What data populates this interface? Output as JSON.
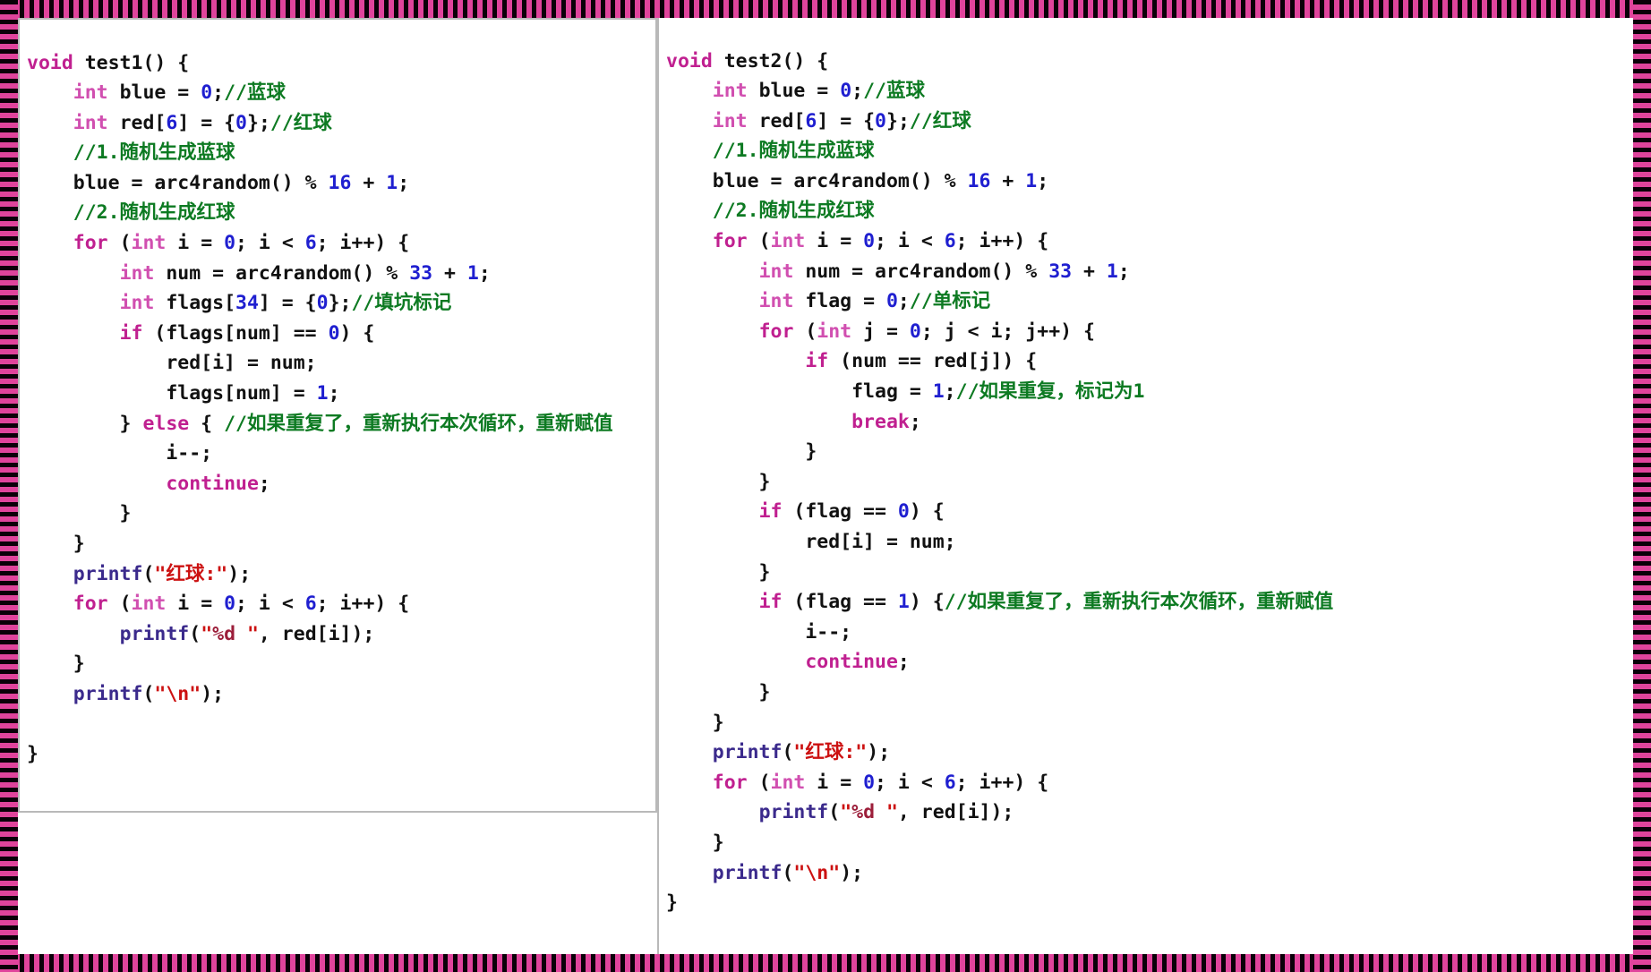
{
  "document": {
    "kind": "code-screenshot",
    "border_pattern": "magenta-black-stripes",
    "colors": {
      "border_magenta": "#e0449c",
      "border_black": "#0a0008",
      "panel_background": "#ffffff",
      "panel_border": "#b9b9b9",
      "keyword": "#c02090",
      "type": "#d14fb0",
      "number": "#1f1fd0",
      "comment": "#0d7a22",
      "string": "#cc1111",
      "format_spec": "#9c1e3a",
      "function": "#3b2a8c",
      "plain_text": "#111111"
    }
  },
  "panels": [
    {
      "id": "left",
      "function_name": "test1",
      "lines": [
        [
          {
            "t": "void",
            "c": "kw"
          },
          {
            "t": " test1() {",
            "c": "plain"
          }
        ],
        [
          {
            "t": "    ",
            "c": "plain"
          },
          {
            "t": "int",
            "c": "typ"
          },
          {
            "t": " blue = ",
            "c": "plain"
          },
          {
            "t": "0",
            "c": "num"
          },
          {
            "t": ";",
            "c": "plain"
          },
          {
            "t": "//蓝球",
            "c": "cmt"
          }
        ],
        [
          {
            "t": "    ",
            "c": "plain"
          },
          {
            "t": "int",
            "c": "typ"
          },
          {
            "t": " red[",
            "c": "plain"
          },
          {
            "t": "6",
            "c": "num"
          },
          {
            "t": "] = {",
            "c": "plain"
          },
          {
            "t": "0",
            "c": "num"
          },
          {
            "t": "};",
            "c": "plain"
          },
          {
            "t": "//红球",
            "c": "cmt"
          }
        ],
        [
          {
            "t": "    ",
            "c": "plain"
          },
          {
            "t": "//1.随机生成蓝球",
            "c": "cmt"
          }
        ],
        [
          {
            "t": "    blue = arc4random() % ",
            "c": "plain"
          },
          {
            "t": "16",
            "c": "num"
          },
          {
            "t": " + ",
            "c": "plain"
          },
          {
            "t": "1",
            "c": "num"
          },
          {
            "t": ";",
            "c": "plain"
          }
        ],
        [
          {
            "t": "    ",
            "c": "plain"
          },
          {
            "t": "//2.随机生成红球",
            "c": "cmt"
          }
        ],
        [
          {
            "t": "    ",
            "c": "plain"
          },
          {
            "t": "for",
            "c": "kw"
          },
          {
            "t": " (",
            "c": "plain"
          },
          {
            "t": "int",
            "c": "typ"
          },
          {
            "t": " i = ",
            "c": "plain"
          },
          {
            "t": "0",
            "c": "num"
          },
          {
            "t": "; i < ",
            "c": "plain"
          },
          {
            "t": "6",
            "c": "num"
          },
          {
            "t": "; i++) {",
            "c": "plain"
          }
        ],
        [
          {
            "t": "        ",
            "c": "plain"
          },
          {
            "t": "int",
            "c": "typ"
          },
          {
            "t": " num = arc4random() % ",
            "c": "plain"
          },
          {
            "t": "33",
            "c": "num"
          },
          {
            "t": " + ",
            "c": "plain"
          },
          {
            "t": "1",
            "c": "num"
          },
          {
            "t": ";",
            "c": "plain"
          }
        ],
        [
          {
            "t": "        ",
            "c": "plain"
          },
          {
            "t": "int",
            "c": "typ"
          },
          {
            "t": " flags[",
            "c": "plain"
          },
          {
            "t": "34",
            "c": "num"
          },
          {
            "t": "] = {",
            "c": "plain"
          },
          {
            "t": "0",
            "c": "num"
          },
          {
            "t": "};",
            "c": "plain"
          },
          {
            "t": "//填坑标记",
            "c": "cmt"
          }
        ],
        [
          {
            "t": "        ",
            "c": "plain"
          },
          {
            "t": "if",
            "c": "kw"
          },
          {
            "t": " (flags[num] == ",
            "c": "plain"
          },
          {
            "t": "0",
            "c": "num"
          },
          {
            "t": ") {",
            "c": "plain"
          }
        ],
        [
          {
            "t": "            red[i] = num;",
            "c": "plain"
          }
        ],
        [
          {
            "t": "            flags[num] = ",
            "c": "plain"
          },
          {
            "t": "1",
            "c": "num"
          },
          {
            "t": ";",
            "c": "plain"
          }
        ],
        [
          {
            "t": "        } ",
            "c": "plain"
          },
          {
            "t": "else",
            "c": "kw"
          },
          {
            "t": " { ",
            "c": "plain"
          },
          {
            "t": "//如果重复了，重新执行本次循环，重新赋值",
            "c": "cmt"
          }
        ],
        [
          {
            "t": "            i--;",
            "c": "plain"
          }
        ],
        [
          {
            "t": "            ",
            "c": "plain"
          },
          {
            "t": "continue",
            "c": "kw"
          },
          {
            "t": ";",
            "c": "plain"
          }
        ],
        [
          {
            "t": "        }",
            "c": "plain"
          }
        ],
        [
          {
            "t": "    }",
            "c": "plain"
          }
        ],
        [
          {
            "t": "    ",
            "c": "plain"
          },
          {
            "t": "printf",
            "c": "fn"
          },
          {
            "t": "(",
            "c": "plain"
          },
          {
            "t": "\"红球:\"",
            "c": "str"
          },
          {
            "t": ");",
            "c": "plain"
          }
        ],
        [
          {
            "t": "    ",
            "c": "plain"
          },
          {
            "t": "for",
            "c": "kw"
          },
          {
            "t": " (",
            "c": "plain"
          },
          {
            "t": "int",
            "c": "typ"
          },
          {
            "t": " i = ",
            "c": "plain"
          },
          {
            "t": "0",
            "c": "num"
          },
          {
            "t": "; i < ",
            "c": "plain"
          },
          {
            "t": "6",
            "c": "num"
          },
          {
            "t": "; i++) {",
            "c": "plain"
          }
        ],
        [
          {
            "t": "        ",
            "c": "plain"
          },
          {
            "t": "printf",
            "c": "fn"
          },
          {
            "t": "(",
            "c": "plain"
          },
          {
            "t": "\"",
            "c": "str"
          },
          {
            "t": "%d",
            "c": "fmt"
          },
          {
            "t": " \"",
            "c": "str"
          },
          {
            "t": ", red[i]);",
            "c": "plain"
          }
        ],
        [
          {
            "t": "    }",
            "c": "plain"
          }
        ],
        [
          {
            "t": "    ",
            "c": "plain"
          },
          {
            "t": "printf",
            "c": "fn"
          },
          {
            "t": "(",
            "c": "plain"
          },
          {
            "t": "\"",
            "c": "str"
          },
          {
            "t": "\\n",
            "c": "str"
          },
          {
            "t": "\"",
            "c": "str"
          },
          {
            "t": ");",
            "c": "plain"
          }
        ],
        [
          {
            "t": "",
            "c": "plain"
          }
        ],
        [
          {
            "t": "}",
            "c": "plain"
          }
        ]
      ]
    },
    {
      "id": "right",
      "function_name": "test2",
      "lines": [
        [
          {
            "t": "void",
            "c": "kw"
          },
          {
            "t": " test2() {",
            "c": "plain"
          }
        ],
        [
          {
            "t": "    ",
            "c": "plain"
          },
          {
            "t": "int",
            "c": "typ"
          },
          {
            "t": " blue = ",
            "c": "plain"
          },
          {
            "t": "0",
            "c": "num"
          },
          {
            "t": ";",
            "c": "plain"
          },
          {
            "t": "//蓝球",
            "c": "cmt"
          }
        ],
        [
          {
            "t": "    ",
            "c": "plain"
          },
          {
            "t": "int",
            "c": "typ"
          },
          {
            "t": " red[",
            "c": "plain"
          },
          {
            "t": "6",
            "c": "num"
          },
          {
            "t": "] = {",
            "c": "plain"
          },
          {
            "t": "0",
            "c": "num"
          },
          {
            "t": "};",
            "c": "plain"
          },
          {
            "t": "//红球",
            "c": "cmt"
          }
        ],
        [
          {
            "t": "    ",
            "c": "plain"
          },
          {
            "t": "//1.随机生成蓝球",
            "c": "cmt"
          }
        ],
        [
          {
            "t": "    blue = arc4random() % ",
            "c": "plain"
          },
          {
            "t": "16",
            "c": "num"
          },
          {
            "t": " + ",
            "c": "plain"
          },
          {
            "t": "1",
            "c": "num"
          },
          {
            "t": ";",
            "c": "plain"
          }
        ],
        [
          {
            "t": "    ",
            "c": "plain"
          },
          {
            "t": "//2.随机生成红球",
            "c": "cmt"
          }
        ],
        [
          {
            "t": "    ",
            "c": "plain"
          },
          {
            "t": "for",
            "c": "kw"
          },
          {
            "t": " (",
            "c": "plain"
          },
          {
            "t": "int",
            "c": "typ"
          },
          {
            "t": " i = ",
            "c": "plain"
          },
          {
            "t": "0",
            "c": "num"
          },
          {
            "t": "; i < ",
            "c": "plain"
          },
          {
            "t": "6",
            "c": "num"
          },
          {
            "t": "; i++) {",
            "c": "plain"
          }
        ],
        [
          {
            "t": "        ",
            "c": "plain"
          },
          {
            "t": "int",
            "c": "typ"
          },
          {
            "t": " num = arc4random() % ",
            "c": "plain"
          },
          {
            "t": "33",
            "c": "num"
          },
          {
            "t": " + ",
            "c": "plain"
          },
          {
            "t": "1",
            "c": "num"
          },
          {
            "t": ";",
            "c": "plain"
          }
        ],
        [
          {
            "t": "        ",
            "c": "plain"
          },
          {
            "t": "int",
            "c": "typ"
          },
          {
            "t": " flag = ",
            "c": "plain"
          },
          {
            "t": "0",
            "c": "num"
          },
          {
            "t": ";",
            "c": "plain"
          },
          {
            "t": "//单标记",
            "c": "cmt"
          }
        ],
        [
          {
            "t": "        ",
            "c": "plain"
          },
          {
            "t": "for",
            "c": "kw"
          },
          {
            "t": " (",
            "c": "plain"
          },
          {
            "t": "int",
            "c": "typ"
          },
          {
            "t": " j = ",
            "c": "plain"
          },
          {
            "t": "0",
            "c": "num"
          },
          {
            "t": "; j < i; j++) {",
            "c": "plain"
          }
        ],
        [
          {
            "t": "            ",
            "c": "plain"
          },
          {
            "t": "if",
            "c": "kw"
          },
          {
            "t": " (num == red[j]) {",
            "c": "plain"
          }
        ],
        [
          {
            "t": "                flag = ",
            "c": "plain"
          },
          {
            "t": "1",
            "c": "num"
          },
          {
            "t": ";",
            "c": "plain"
          },
          {
            "t": "//如果重复，标记为1",
            "c": "cmt"
          }
        ],
        [
          {
            "t": "                ",
            "c": "plain"
          },
          {
            "t": "break",
            "c": "kw"
          },
          {
            "t": ";",
            "c": "plain"
          }
        ],
        [
          {
            "t": "            }",
            "c": "plain"
          }
        ],
        [
          {
            "t": "        }",
            "c": "plain"
          }
        ],
        [
          {
            "t": "        ",
            "c": "plain"
          },
          {
            "t": "if",
            "c": "kw"
          },
          {
            "t": " (flag == ",
            "c": "plain"
          },
          {
            "t": "0",
            "c": "num"
          },
          {
            "t": ") {",
            "c": "plain"
          }
        ],
        [
          {
            "t": "            red[i] = num;",
            "c": "plain"
          }
        ],
        [
          {
            "t": "        }",
            "c": "plain"
          }
        ],
        [
          {
            "t": "        ",
            "c": "plain"
          },
          {
            "t": "if",
            "c": "kw"
          },
          {
            "t": " (flag == ",
            "c": "plain"
          },
          {
            "t": "1",
            "c": "num"
          },
          {
            "t": ") {",
            "c": "plain"
          },
          {
            "t": "//如果重复了，重新执行本次循环，重新赋值",
            "c": "cmt"
          }
        ],
        [
          {
            "t": "            i--;",
            "c": "plain"
          }
        ],
        [
          {
            "t": "            ",
            "c": "plain"
          },
          {
            "t": "continue",
            "c": "kw"
          },
          {
            "t": ";",
            "c": "plain"
          }
        ],
        [
          {
            "t": "        }",
            "c": "plain"
          }
        ],
        [
          {
            "t": "    }",
            "c": "plain"
          }
        ],
        [
          {
            "t": "    ",
            "c": "plain"
          },
          {
            "t": "printf",
            "c": "fn"
          },
          {
            "t": "(",
            "c": "plain"
          },
          {
            "t": "\"红球:\"",
            "c": "str"
          },
          {
            "t": ");",
            "c": "plain"
          }
        ],
        [
          {
            "t": "    ",
            "c": "plain"
          },
          {
            "t": "for",
            "c": "kw"
          },
          {
            "t": " (",
            "c": "plain"
          },
          {
            "t": "int",
            "c": "typ"
          },
          {
            "t": " i = ",
            "c": "plain"
          },
          {
            "t": "0",
            "c": "num"
          },
          {
            "t": "; i < ",
            "c": "plain"
          },
          {
            "t": "6",
            "c": "num"
          },
          {
            "t": "; i++) {",
            "c": "plain"
          }
        ],
        [
          {
            "t": "        ",
            "c": "plain"
          },
          {
            "t": "printf",
            "c": "fn"
          },
          {
            "t": "(",
            "c": "plain"
          },
          {
            "t": "\"",
            "c": "str"
          },
          {
            "t": "%d",
            "c": "fmt"
          },
          {
            "t": " \"",
            "c": "str"
          },
          {
            "t": ", red[i]);",
            "c": "plain"
          }
        ],
        [
          {
            "t": "    }",
            "c": "plain"
          }
        ],
        [
          {
            "t": "    ",
            "c": "plain"
          },
          {
            "t": "printf",
            "c": "fn"
          },
          {
            "t": "(",
            "c": "plain"
          },
          {
            "t": "\"",
            "c": "str"
          },
          {
            "t": "\\n",
            "c": "str"
          },
          {
            "t": "\"",
            "c": "str"
          },
          {
            "t": ");",
            "c": "plain"
          }
        ],
        [
          {
            "t": "}",
            "c": "plain"
          }
        ]
      ]
    }
  ]
}
